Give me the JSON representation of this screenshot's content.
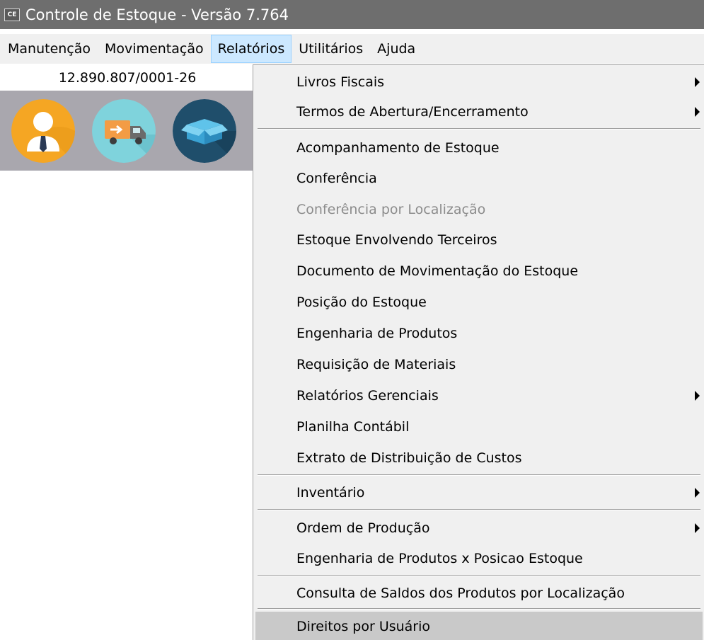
{
  "window": {
    "icon_text": "CE",
    "title": "Controle de Estoque - Versão 7.764"
  },
  "menubar": {
    "items": [
      {
        "label": "Manutenção"
      },
      {
        "label": "Movimentação"
      },
      {
        "label": "Relatórios",
        "active": true
      },
      {
        "label": "Utilitários"
      },
      {
        "label": "Ajuda"
      }
    ]
  },
  "company": {
    "cnpj": "12.890.807/0001-26"
  },
  "toolbar": {
    "buttons": [
      {
        "icon": "user-icon",
        "color": "#f5a623"
      },
      {
        "icon": "delivery-truck-icon",
        "color": "#7fd3dc"
      },
      {
        "icon": "box-icon",
        "color": "#1f4e6b"
      }
    ]
  },
  "relatorios_menu": {
    "items": [
      {
        "label": "Livros Fiscais",
        "submenu": true
      },
      {
        "label": "Termos de Abertura/Encerramento",
        "submenu": true
      },
      {
        "label": "Acompanhamento de Estoque"
      },
      {
        "label": "Conferência"
      },
      {
        "label": "Conferência por Localização",
        "disabled": true
      },
      {
        "label": "Estoque Envolvendo Terceiros"
      },
      {
        "label": "Documento de Movimentação do Estoque"
      },
      {
        "label": "Posição do Estoque"
      },
      {
        "label": "Engenharia de Produtos"
      },
      {
        "label": "Requisição de Materiais"
      },
      {
        "label": "Relatórios Gerenciais",
        "submenu": true
      },
      {
        "label": "Planilha Contábil"
      },
      {
        "label": "Extrato de Distribuição de Custos"
      },
      {
        "label": "Inventário",
        "submenu": true
      },
      {
        "label": "Ordem de Produção",
        "submenu": true
      },
      {
        "label": "Engenharia de Produtos x Posicao Estoque"
      },
      {
        "label": "Consulta de Saldos dos Produtos por Localização"
      },
      {
        "label": "Direitos por Usuário",
        "highlighted": true
      }
    ]
  },
  "colors": {
    "titlebar": "#6e6e6e",
    "menubar": "#f0f0f0",
    "menu_active": "#cce8ff",
    "toolbar_bg": "#a9a7ae",
    "disabled_text": "#8c8c8c",
    "highlight_row": "#c9c9c9"
  }
}
